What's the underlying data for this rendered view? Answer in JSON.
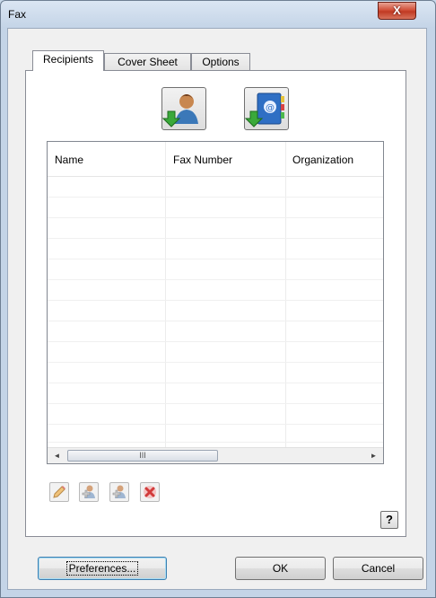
{
  "window": {
    "title": "Fax",
    "close_glyph": "X"
  },
  "tabs": [
    {
      "label": "Recipients",
      "active": true
    },
    {
      "label": "Cover Sheet",
      "active": false
    },
    {
      "label": "Options",
      "active": false
    }
  ],
  "icons": {
    "add_from_contacts": "contact-person-download-icon",
    "add_from_address_book": "address-book-download-icon",
    "edit": "pencil-edit-icon",
    "add_recipient": "add-recipient-icon",
    "add_recipient_alt": "add-recipient-alt-icon",
    "delete": "delete-x-icon"
  },
  "recipients_table": {
    "columns": [
      "Name",
      "Fax Number",
      "Organization"
    ],
    "rows": []
  },
  "scrollbar": {
    "left_arrow": "◄",
    "right_arrow": "►",
    "thumb_grip": "III"
  },
  "help_label": "?",
  "buttons": {
    "preferences": "Preferences...",
    "ok": "OK",
    "cancel": "Cancel"
  },
  "colors": {
    "close_button": "#c8432b",
    "titlebar": "#c4d4e7",
    "dialog_face": "#f0f0f0"
  }
}
